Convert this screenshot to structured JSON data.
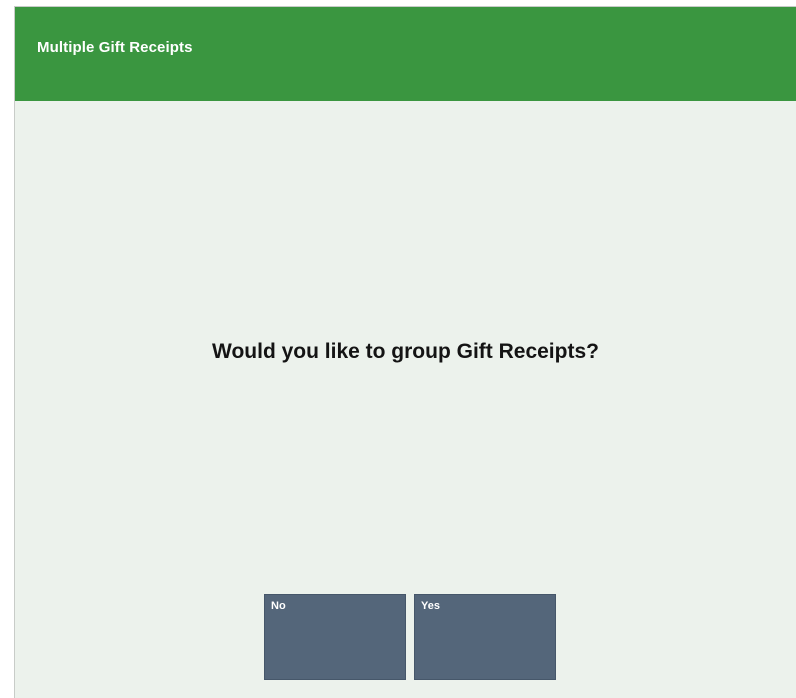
{
  "dialog": {
    "title": "Multiple Gift Receipts",
    "prompt": "Would you like to group Gift Receipts?"
  },
  "buttons": {
    "no_label": "No",
    "yes_label": "Yes"
  },
  "colors": {
    "title_bar": "#3a9640",
    "background": "#ecf2ec",
    "button": "#54667a",
    "title_text": "#ffffff",
    "prompt_text": "#141414"
  }
}
